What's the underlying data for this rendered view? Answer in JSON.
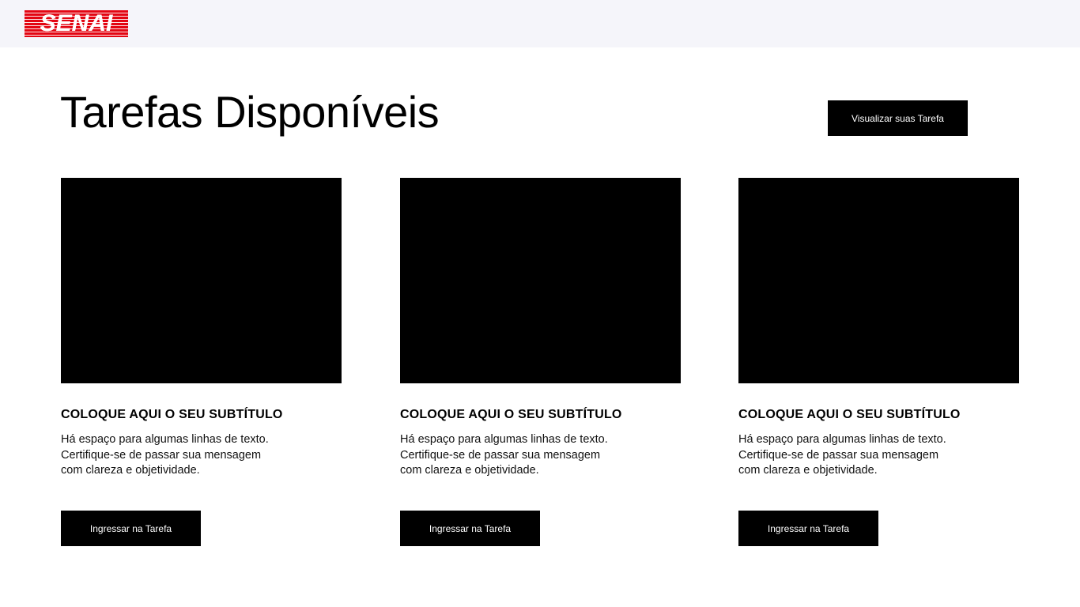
{
  "header": {
    "logo_text": "SENAI",
    "brand_color": "#e30613"
  },
  "main": {
    "title": "Tarefas Disponíveis",
    "view_tasks_button": "Visualizar suas Tarefa",
    "cards": [
      {
        "subtitle": "COLOQUE AQUI O SEU SUBTÍTULO",
        "lines": [
          "Há espaço para algumas linhas de texto.",
          "Certifique-se de passar sua mensagem",
          "com clareza e objetividade."
        ],
        "button": "Ingressar na Tarefa"
      },
      {
        "subtitle": "COLOQUE AQUI O SEU SUBTÍTULO",
        "lines": [
          "Há espaço para algumas linhas de texto.",
          "Certifique-se de passar sua mensagem",
          "com clareza e objetividade."
        ],
        "button": "Ingressar na Tarefa"
      },
      {
        "subtitle": "COLOQUE AQUI O SEU SUBTÍTULO",
        "lines": [
          "Há espaço para algumas linhas de texto.",
          "Certifique-se de passar sua mensagem",
          "com clareza e objetividade."
        ],
        "button": "Ingressar na Tarefa"
      }
    ]
  }
}
